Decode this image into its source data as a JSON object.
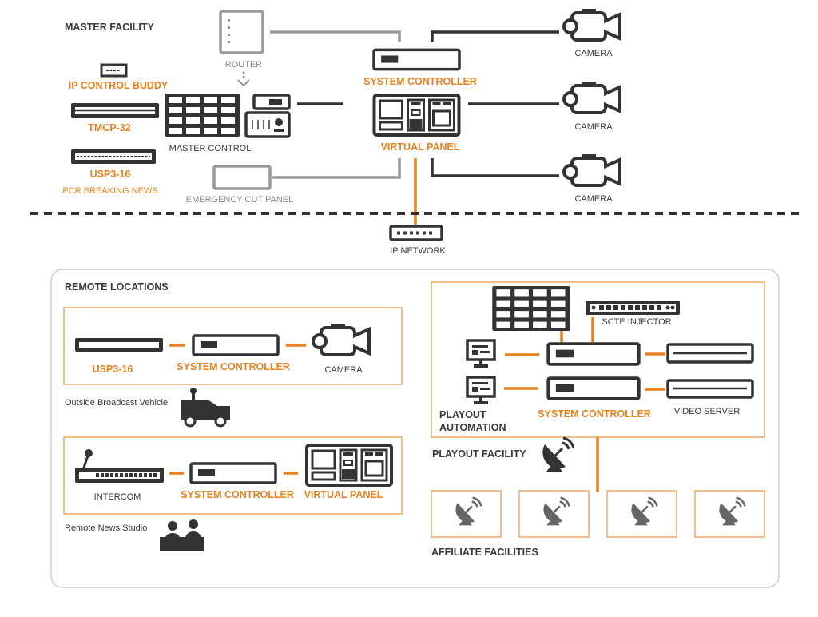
{
  "colors": {
    "accent": "#e8821e",
    "dark": "#333333",
    "grey": "#999999"
  },
  "master": {
    "title": "MASTER FACILITY",
    "router": "ROUTER",
    "ip_control_buddy": "IP CONTROL BUDDY",
    "tmcp": "TMCP-32",
    "usp": "USP3-16",
    "pcr": "PCR BREAKING NEWS",
    "master_control": "MASTER CONTROL",
    "emergency": "EMERGENCY CUT PANEL",
    "system_controller": "SYSTEM CONTROLLER",
    "virtual_panel": "VIRTUAL PANEL",
    "cameras": [
      "CAMERA",
      "CAMERA",
      "CAMERA"
    ]
  },
  "network": {
    "label": "IP NETWORK"
  },
  "remote": {
    "title": "REMOTE LOCATIONS",
    "ob": {
      "usp": "USP3-16",
      "system_controller": "SYSTEM CONTROLLER",
      "camera": "CAMERA",
      "caption": "Outside Broadcast Vehicle"
    },
    "studio": {
      "intercom": "INTERCOM",
      "system_controller": "SYSTEM CONTROLLER",
      "virtual_panel": "VIRTUAL PANEL",
      "caption": "Remote News Studio"
    }
  },
  "playout": {
    "scte": "SCTE INJECTOR",
    "automation_1": "PLAYOUT",
    "automation_2": "AUTOMATION",
    "system_controller": "SYSTEM CONTROLLER",
    "video_server": "VIDEO SERVER",
    "title": "PLAYOUT FACILITY"
  },
  "affiliates": {
    "title": "AFFILIATE FACILITIES",
    "count": 4
  }
}
